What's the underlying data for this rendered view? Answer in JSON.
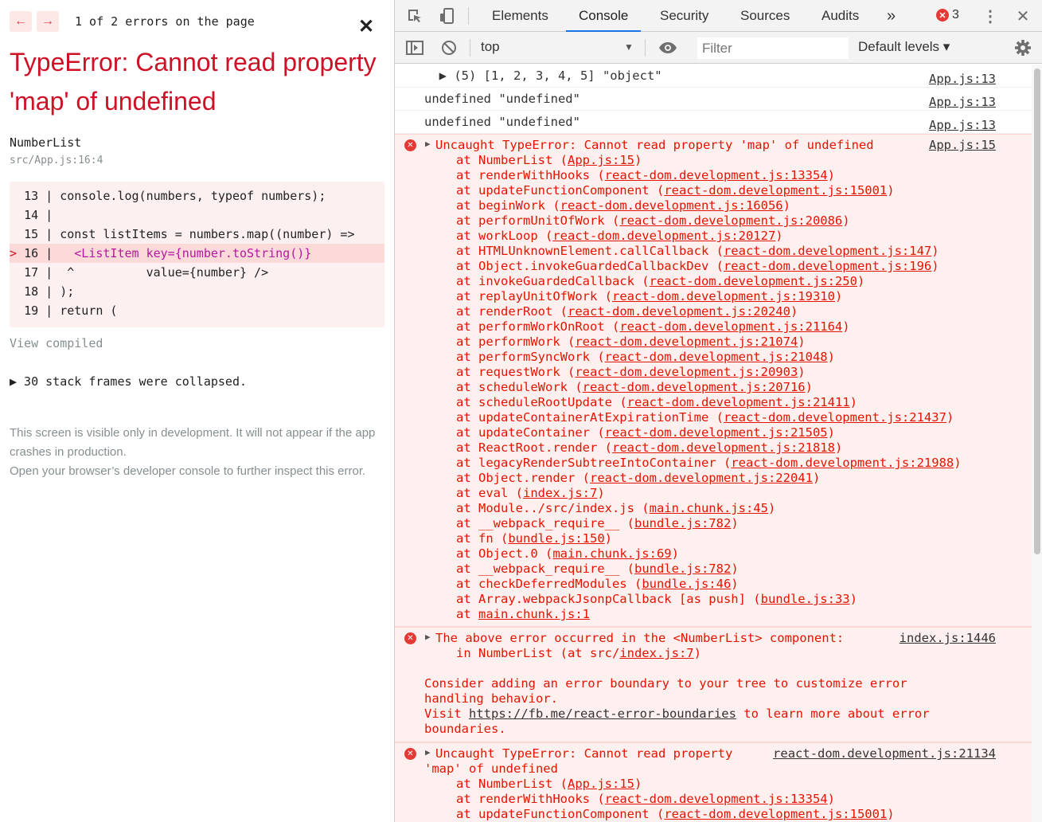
{
  "overlay": {
    "nav_prev": "←",
    "nav_next": "→",
    "error_count_text": "1 of 2 errors on the page",
    "close_glyph": "✕",
    "headline": "TypeError: Cannot read property 'map' of undefined",
    "component": "NumberList",
    "location": "src/App.js:16:4",
    "code_lines": [
      {
        "num": "13",
        "marker": " ",
        "text": "console.log(numbers, typeof numbers);"
      },
      {
        "num": "14",
        "marker": " ",
        "text": ""
      },
      {
        "num": "15",
        "marker": " ",
        "text": "const listItems = numbers.map((number) =>"
      },
      {
        "num": "16",
        "marker": ">",
        "text": "  <ListItem key={number.toString()}"
      },
      {
        "num": "17",
        "marker": " ",
        "text": " ^          value={number} />"
      },
      {
        "num": "18",
        "marker": " ",
        "text": ");"
      },
      {
        "num": "19",
        "marker": " ",
        "text": "return ("
      }
    ],
    "view_compiled": "View compiled",
    "collapsed": "▶ 30 stack frames were collapsed.",
    "footer_line1": "This screen is visible only in development. It will not appear if the app crashes in production.",
    "footer_line2": "Open your browser’s developer console to further inspect this error."
  },
  "devtools": {
    "tabs": [
      "Elements",
      "Console",
      "Security",
      "Sources",
      "Audits"
    ],
    "active_tab": "Console",
    "more_tabs": "»",
    "error_badge_count": "3",
    "context": "top",
    "filter_placeholder": "Filter",
    "levels": "Default levels ▾",
    "logs": [
      {
        "text": "▶ (5) [1, 2, 3, 4, 5] \"object\"",
        "source": "App.js:13"
      },
      {
        "text": "undefined \"undefined\"",
        "source": "App.js:13"
      },
      {
        "text": "undefined \"undefined\"",
        "source": "App.js:13"
      }
    ],
    "error1": {
      "head": "Uncaught TypeError: Cannot read property 'map' of undefined",
      "source": "App.js:15",
      "frames": [
        {
          "fn": "NumberList",
          "loc": "App.js:15"
        },
        {
          "fn": "renderWithHooks",
          "loc": "react-dom.development.js:13354"
        },
        {
          "fn": "updateFunctionComponent",
          "loc": "react-dom.development.js:15001"
        },
        {
          "fn": "beginWork",
          "loc": "react-dom.development.js:16056"
        },
        {
          "fn": "performUnitOfWork",
          "loc": "react-dom.development.js:20086"
        },
        {
          "fn": "workLoop",
          "loc": "react-dom.development.js:20127"
        },
        {
          "fn": "HTMLUnknownElement.callCallback",
          "loc": "react-dom.development.js:147"
        },
        {
          "fn": "Object.invokeGuardedCallbackDev",
          "loc": "react-dom.development.js:196"
        },
        {
          "fn": "invokeGuardedCallback",
          "loc": "react-dom.development.js:250"
        },
        {
          "fn": "replayUnitOfWork",
          "loc": "react-dom.development.js:19310"
        },
        {
          "fn": "renderRoot",
          "loc": "react-dom.development.js:20240"
        },
        {
          "fn": "performWorkOnRoot",
          "loc": "react-dom.development.js:21164"
        },
        {
          "fn": "performWork",
          "loc": "react-dom.development.js:21074"
        },
        {
          "fn": "performSyncWork",
          "loc": "react-dom.development.js:21048"
        },
        {
          "fn": "requestWork",
          "loc": "react-dom.development.js:20903"
        },
        {
          "fn": "scheduleWork",
          "loc": "react-dom.development.js:20716"
        },
        {
          "fn": "scheduleRootUpdate",
          "loc": "react-dom.development.js:21411"
        },
        {
          "fn": "updateContainerAtExpirationTime",
          "loc": "react-dom.development.js:21437"
        },
        {
          "fn": "updateContainer",
          "loc": "react-dom.development.js:21505"
        },
        {
          "fn": "ReactRoot.render",
          "loc": "react-dom.development.js:21818"
        },
        {
          "fn": "legacyRenderSubtreeIntoContainer",
          "loc": "react-dom.development.js:21988"
        },
        {
          "fn": "Object.render",
          "loc": "react-dom.development.js:22041"
        },
        {
          "fn": "eval",
          "loc": "index.js:7"
        },
        {
          "fn": "Module../src/index.js",
          "loc": "main.chunk.js:45"
        },
        {
          "fn": "__webpack_require__",
          "loc": "bundle.js:782"
        },
        {
          "fn": "fn",
          "loc": "bundle.js:150"
        },
        {
          "fn": "Object.0",
          "loc": "main.chunk.js:69"
        },
        {
          "fn": "__webpack_require__",
          "loc": "bundle.js:782"
        },
        {
          "fn": "checkDeferredModules",
          "loc": "bundle.js:46"
        },
        {
          "fn": "Array.webpackJsonpCallback [as push]",
          "loc": "bundle.js:33"
        },
        {
          "fn": "",
          "loc": "main.chunk.js:1"
        }
      ]
    },
    "error2": {
      "head": "The above error occurred in the <NumberList> component:",
      "source": "index.js:1446",
      "line2_prefix": "in NumberList (at src/",
      "line2_link": "index.js:7",
      "line2_suffix": ")",
      "line3": "Consider adding an error boundary to your tree to customize error",
      "line4": "handling behavior.",
      "line5_prefix": "Visit ",
      "line5_link": "https://fb.me/react-error-boundaries",
      "line5_suffix": " to learn more about error",
      "line6": "boundaries."
    },
    "error3": {
      "head": "Uncaught TypeError: Cannot read property",
      "head2": "'map' of undefined",
      "source": "react-dom.development.js:21134",
      "frames": [
        {
          "fn": "NumberList",
          "loc": "App.js:15"
        },
        {
          "fn": "renderWithHooks",
          "loc": "react-dom.development.js:13354"
        },
        {
          "fn": "updateFunctionComponent",
          "loc": "react-dom.development.js:15001"
        }
      ]
    }
  },
  "colors": {
    "error_red": "#e51400",
    "headline_red": "#ce1126",
    "error_bg": "#fff0f0",
    "active_tab": "#1a73e8"
  }
}
